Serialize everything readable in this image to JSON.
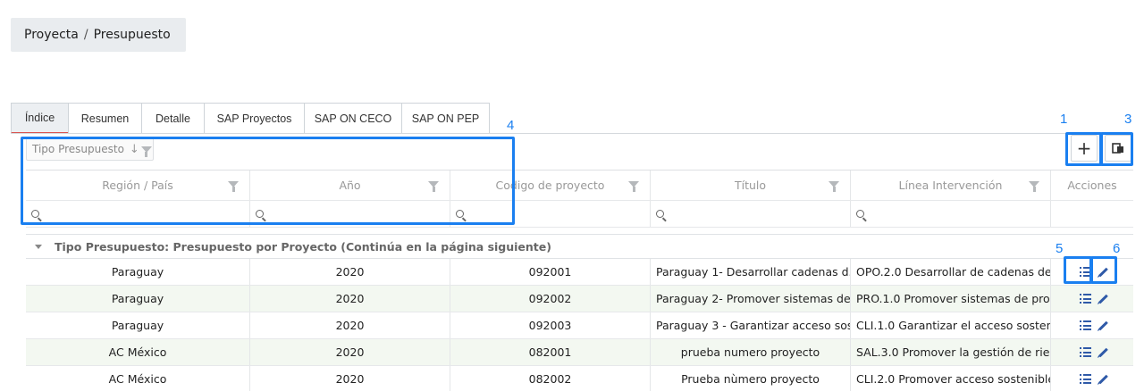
{
  "breadcrumb": {
    "root": "Proyecta",
    "separator": "/",
    "current": "Presupuesto"
  },
  "tabs": [
    {
      "label": "Índice",
      "active": true
    },
    {
      "label": "Resumen",
      "active": false
    },
    {
      "label": "Detalle",
      "active": false
    },
    {
      "label": "SAP Proyectos",
      "active": false
    },
    {
      "label": "SAP ON CECO",
      "active": false
    },
    {
      "label": "SAP ON PEP",
      "active": false
    }
  ],
  "group_panel": {
    "chip_label": "Tipo Presupuesto"
  },
  "toolbar": {
    "add_icon": "plus-icon",
    "export_icon": "copy-icon"
  },
  "columns": [
    "Región / País",
    "Año",
    "Codigo de proyecto",
    "Título",
    "Línea Intervención",
    "Acciones"
  ],
  "group_row": "Tipo Presupuesto: Presupuesto por Proyecto (Continúa en la página siguiente)",
  "rows": [
    {
      "region": "Paraguay",
      "year": "2020",
      "code": "092001",
      "title": "Paraguay 1- Desarrollar cadenas d...",
      "line": "OPO.2.0 Desarrollar de cadenas de..."
    },
    {
      "region": "Paraguay",
      "year": "2020",
      "code": "092002",
      "title": "Paraguay 2- Promover sistemas de...",
      "line": "PRO.1.0 Promover sistemas de pro..."
    },
    {
      "region": "Paraguay",
      "year": "2020",
      "code": "092003",
      "title": "Paraguay 3 - Garantizar acceso sos...",
      "line": "CLI.1.0 Garantizar el acceso sosteni..."
    },
    {
      "region": "AC México",
      "year": "2020",
      "code": "082001",
      "title": "prueba numero proyecto",
      "line": "SAL.3.0 Promover la gestión de rie..."
    },
    {
      "region": "AC México",
      "year": "2020",
      "code": "082002",
      "title": "Prueba nùmero proyecto",
      "line": "CLI.2.0 Promover acceso sostenible..."
    }
  ],
  "annotations": [
    "1",
    "3",
    "4",
    "5",
    "6"
  ],
  "colors": {
    "accent": "#1a7ff0",
    "icon_blue": "#2f5aa8",
    "active_tab_underline": "#d9534f",
    "alt_row": "#f3f8f1"
  }
}
